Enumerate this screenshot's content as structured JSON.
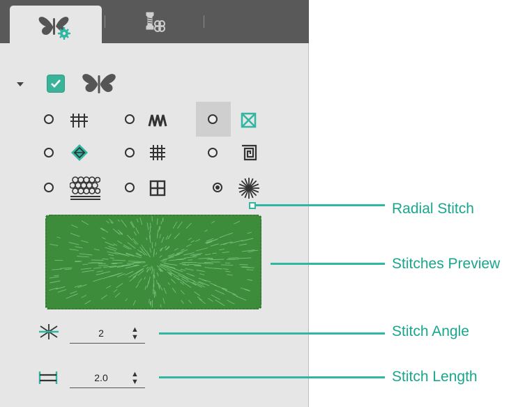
{
  "tabs": [
    {
      "name": "butterfly-properties",
      "icon": "butterfly-gear-icon",
      "active": true
    },
    {
      "name": "thread-colors",
      "icon": "thread-spools-icon",
      "active": false
    }
  ],
  "accent_color": "#2fb7a1",
  "stitch_types": [
    {
      "icon": "satin-run-stitch-icon",
      "selected": false
    },
    {
      "icon": "zigzag-stitch-icon",
      "selected": false
    },
    {
      "icon": "cross-box-stitch-icon",
      "selected": false
    },
    {
      "icon": "diamond-fill-stitch-icon",
      "selected": false
    },
    {
      "icon": "weave-fill-stitch-icon",
      "selected": false
    },
    {
      "icon": "spiral-stitch-icon",
      "selected": false
    },
    {
      "icon": "motif-fill-stitch-icon",
      "selected": false
    },
    {
      "icon": "grid-fill-stitch-icon",
      "selected": false
    },
    {
      "icon": "radial-stitch-icon",
      "selected": true
    }
  ],
  "stitch_angle": {
    "value": "2",
    "icon": "angle-icon"
  },
  "stitch_length": {
    "value": "2.0",
    "icon": "length-icon"
  },
  "callouts": {
    "radial_stitch": "Radial Stitch",
    "stitches_preview": "Stitches Preview",
    "stitch_angle": "Stitch Angle",
    "stitch_length": "Stitch Length"
  }
}
